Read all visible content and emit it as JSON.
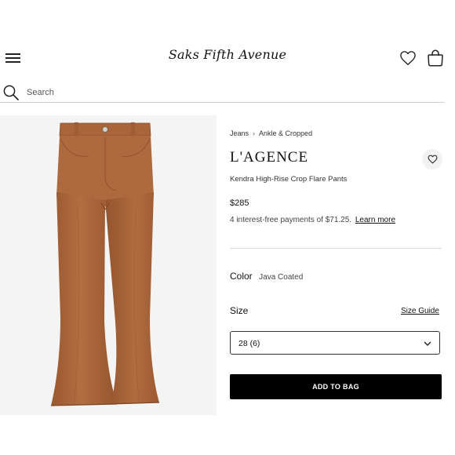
{
  "header": {
    "logo_text": "Saks Fifth Avenue",
    "menu_icon": "hamburger-icon",
    "wishlist_icon": "heart-icon",
    "bag_icon": "shopping-bag-icon"
  },
  "search": {
    "placeholder": "Search",
    "icon": "search-icon"
  },
  "product": {
    "image_icon": "product-image",
    "breadcrumb": [
      "Jeans",
      "Ankle & Cropped"
    ],
    "brand": "L'AGENCE",
    "name": "Kendra High-Rise Crop Flare Pants",
    "price": "$285",
    "installments_text": "4 interest-free payments of $71.25.",
    "learn_more": "Learn more",
    "color_label": "Color",
    "color_value": "Java Coated",
    "size_label": "Size",
    "size_guide": "Size Guide",
    "size_selected": "28 (6)",
    "add_to_bag": "ADD TO BAG",
    "pants_color": "#a9653a"
  }
}
